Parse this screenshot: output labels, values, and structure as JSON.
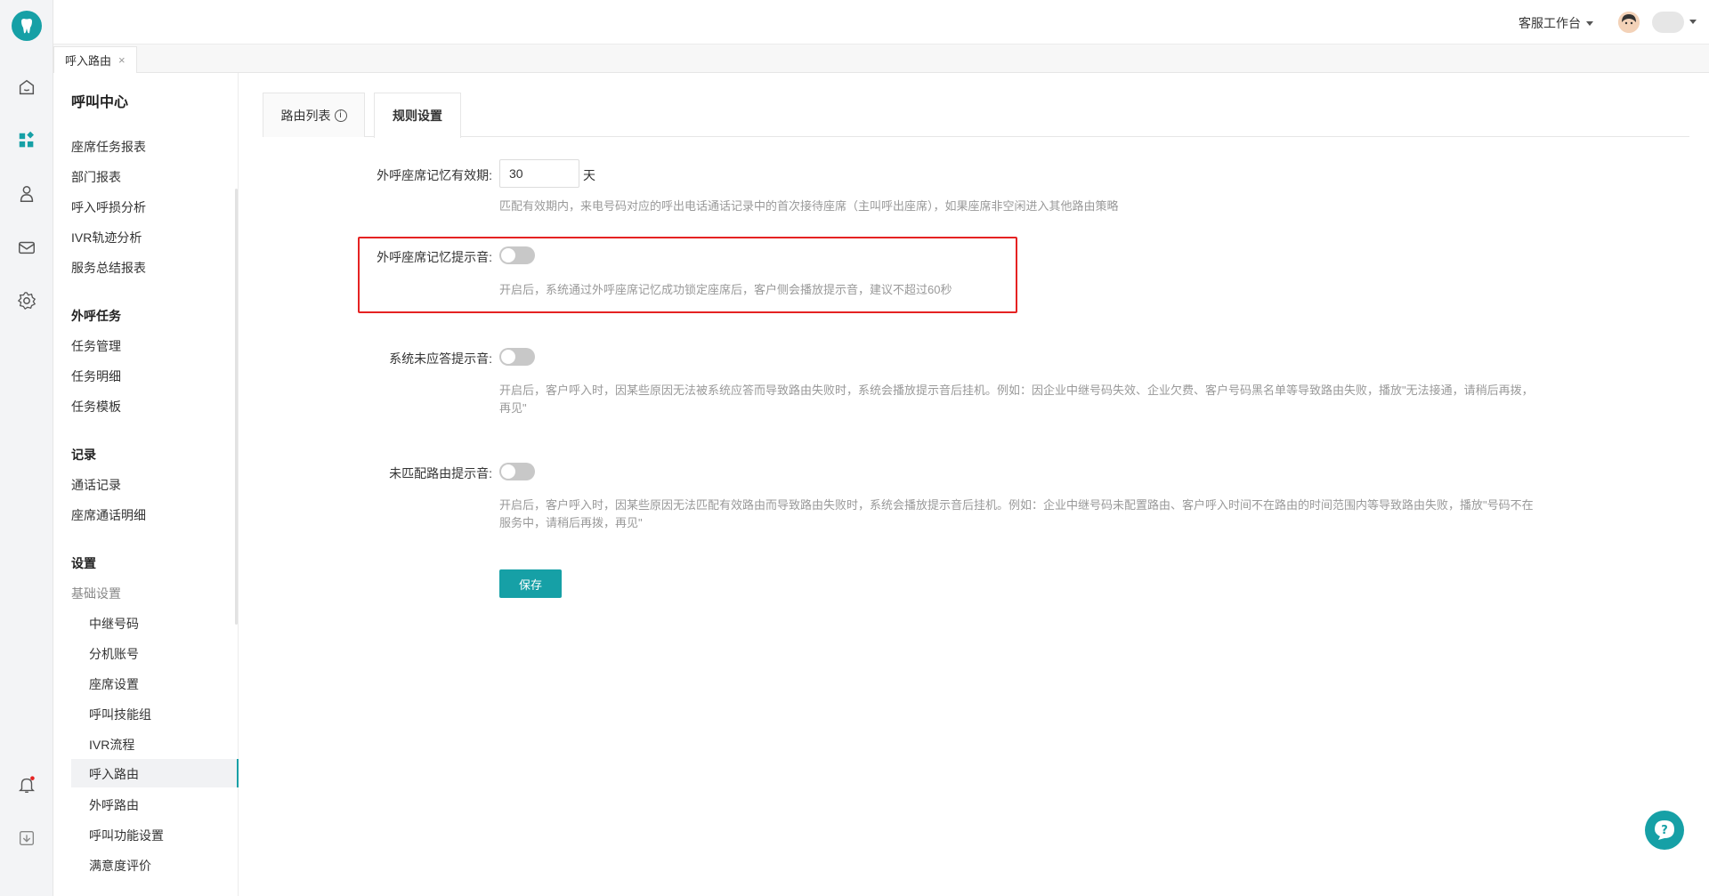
{
  "topbar": {
    "workspace_label": "客服工作台"
  },
  "page_tab": {
    "label": "呼入路由",
    "close": "×"
  },
  "sidebar": {
    "title": "呼叫中心",
    "items_report": [
      "座席任务报表",
      "部门报表",
      "呼入呼损分析",
      "IVR轨迹分析",
      "服务总结报表"
    ],
    "group_outbound": "外呼任务",
    "items_outbound": [
      "任务管理",
      "任务明细",
      "任务模板"
    ],
    "group_records": "记录",
    "items_records": [
      "通话记录",
      "座席通话明细"
    ],
    "group_settings": "设置",
    "basic_settings": "基础设置",
    "items_settings": [
      "中继号码",
      "分机账号",
      "座席设置",
      "呼叫技能组",
      "IVR流程",
      "呼入路由",
      "外呼路由",
      "呼叫功能设置",
      "满意度评价"
    ],
    "active_item": "呼入路由"
  },
  "tabs": {
    "route_list": "路由列表",
    "info": "i",
    "rule_settings": "规则设置"
  },
  "form": {
    "memory_period_label": "外呼座席记忆有效期:",
    "memory_period_value": "30",
    "memory_period_unit": "天",
    "memory_period_desc": "匹配有效期内，来电号码对应的呼出电话通话记录中的首次接待座席（主叫呼出座席），如果座席非空闲进入其他路由策略",
    "memory_tone_label": "外呼座席记忆提示音:",
    "memory_tone_on": false,
    "memory_tone_desc": "开启后，系统通过外呼座席记忆成功锁定座席后，客户侧会播放提示音，建议不超过60秒",
    "no_answer_label": "系统未应答提示音:",
    "no_answer_on": false,
    "no_answer_desc": "开启后，客户呼入时，因某些原因无法被系统应答而导致路由失败时，系统会播放提示音后挂机。例如：因企业中继号码失效、企业欠费、客户号码黑名单等导致路由失败，播放\"无法接通，请稍后再拨，再见\"",
    "unmatched_label": "未匹配路由提示音:",
    "unmatched_on": false,
    "unmatched_desc": "开启后，客户呼入时，因某些原因无法匹配有效路由而导致路由失败时，系统会播放提示音后挂机。例如：企业中继号码未配置路由、客户呼入时间不在路由的时间范围内等导致路由失败，播放\"号码不在服务中，请稍后再拨，再见\"",
    "save_label": "保存"
  },
  "colors": {
    "accent": "#16a0a6",
    "highlight_border": "#e52222"
  },
  "icons": [
    "logo-icon",
    "home-icon",
    "apps-icon",
    "contacts-icon",
    "mail-icon",
    "settings-icon",
    "bell-icon",
    "download-icon",
    "help-icon"
  ]
}
